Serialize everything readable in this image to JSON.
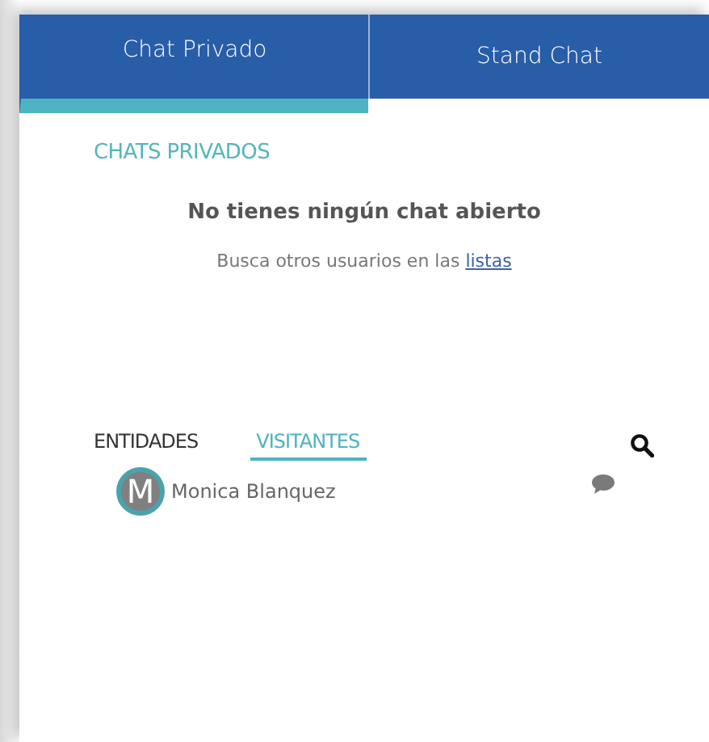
{
  "tabs": [
    {
      "label": "Chat Privado",
      "selected": true
    },
    {
      "label": "Stand Chat",
      "selected": false
    }
  ],
  "section_title": "CHATS PRIVADOS",
  "empty_state": {
    "title": "No tienes ningún chat abierto",
    "hint": "Busca otros usuarios en las",
    "link": "listas"
  },
  "list_tabs": [
    {
      "label": "ENTIDADES",
      "selected": false
    },
    {
      "label": "VISITANTES",
      "selected": true
    }
  ],
  "users": [
    {
      "initial": "M",
      "name": "Monica Blanquez"
    }
  ]
}
